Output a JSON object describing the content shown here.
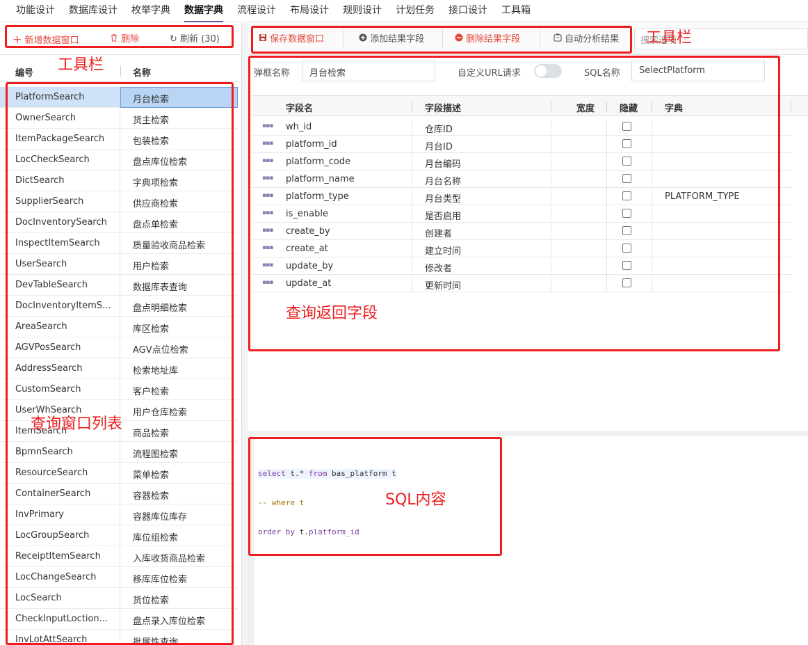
{
  "topnav": {
    "tabs": [
      {
        "label": "功能设计",
        "active": false
      },
      {
        "label": "数据库设计",
        "active": false
      },
      {
        "label": "枚举字典",
        "active": false
      },
      {
        "label": "数据字典",
        "active": true
      },
      {
        "label": "流程设计",
        "active": false
      },
      {
        "label": "布局设计",
        "active": false
      },
      {
        "label": "规则设计",
        "active": false
      },
      {
        "label": "计划任务",
        "active": false
      },
      {
        "label": "接口设计",
        "active": false
      },
      {
        "label": "工具箱",
        "active": false
      }
    ]
  },
  "left_toolbar": {
    "add_label": "新增数据窗口",
    "delete_label": "删除",
    "refresh_label": "刷新 (30)"
  },
  "left_table": {
    "headers": {
      "code": "编号",
      "name": "名称"
    },
    "rows": [
      {
        "code": "PlatformSearch",
        "name": "月台检索",
        "selected": true
      },
      {
        "code": "OwnerSearch",
        "name": "货主检索"
      },
      {
        "code": "ItemPackageSearch",
        "name": "包装检索"
      },
      {
        "code": "LocCheckSearch",
        "name": "盘点库位检索"
      },
      {
        "code": "DictSearch",
        "name": "字典项检索"
      },
      {
        "code": "SupplierSearch",
        "name": "供应商检索"
      },
      {
        "code": "DocInventorySearch",
        "name": "盘点单检索"
      },
      {
        "code": "InspectItemSearch",
        "name": "质量验收商品检索"
      },
      {
        "code": "UserSearch",
        "name": "用户检索"
      },
      {
        "code": "DevTableSearch",
        "name": "数据库表查询"
      },
      {
        "code": "DocInventoryItemS...",
        "name": "盘点明细检索"
      },
      {
        "code": "AreaSearch",
        "name": "库区检索"
      },
      {
        "code": "AGVPosSearch",
        "name": "AGV点位检索"
      },
      {
        "code": "AddressSearch",
        "name": "检索地址库"
      },
      {
        "code": "CustomSearch",
        "name": "客户检索"
      },
      {
        "code": "UserWhSearch",
        "name": "用户仓库检索"
      },
      {
        "code": "ItemSearch",
        "name": "商品检索"
      },
      {
        "code": "BpmnSearch",
        "name": "流程图检索"
      },
      {
        "code": "ResourceSearch",
        "name": "菜单检索"
      },
      {
        "code": "ContainerSearch",
        "name": "容器检索"
      },
      {
        "code": "InvPrimary",
        "name": "容器库位库存"
      },
      {
        "code": "LocGroupSearch",
        "name": "库位组检索"
      },
      {
        "code": "ReceiptItemSearch",
        "name": "入库收货商品检索"
      },
      {
        "code": "LocChangeSearch",
        "name": "移库库位检索"
      },
      {
        "code": "LocSearch",
        "name": "货位检索"
      },
      {
        "code": "CheckInputLoction...",
        "name": "盘点录入库位检索"
      },
      {
        "code": "InvLotAttSearch",
        "name": "批属性查询"
      }
    ]
  },
  "right_toolbar": {
    "save_label": "保存数据窗口",
    "add_field_label": "添加结果字段",
    "delete_field_label": "删除结果字段",
    "auto_analyze_label": "自动分析结果",
    "search_placeholder": "搜索选项"
  },
  "form": {
    "popup_name_label": "弹框名称",
    "popup_name_value": "月台检索",
    "custom_url_label": "自定义URL请求",
    "custom_url_enabled": false,
    "sql_name_label": "SQL名称",
    "sql_name_value": "SelectPlatform"
  },
  "fields_grid": {
    "headers": {
      "field": "字段名",
      "desc": "字段描述",
      "width": "宽度",
      "hidden": "隐藏",
      "dict": "字典"
    },
    "rows": [
      {
        "field": "wh_id",
        "desc": "仓库ID",
        "dict": ""
      },
      {
        "field": "platform_id",
        "desc": "月台ID",
        "dict": ""
      },
      {
        "field": "platform_code",
        "desc": "月台编码",
        "dict": ""
      },
      {
        "field": "platform_name",
        "desc": "月台名称",
        "dict": ""
      },
      {
        "field": "platform_type",
        "desc": "月台类型",
        "dict": "PLATFORM_TYPE"
      },
      {
        "field": "is_enable",
        "desc": "是否启用",
        "dict": ""
      },
      {
        "field": "create_by",
        "desc": "创建者",
        "dict": ""
      },
      {
        "field": "create_at",
        "desc": "建立时间",
        "dict": ""
      },
      {
        "field": "update_by",
        "desc": "修改者",
        "dict": ""
      },
      {
        "field": "update_at",
        "desc": "更新时间",
        "dict": ""
      }
    ]
  },
  "sql_editor": {
    "line1": {
      "k1": "select",
      "t1": " t.* ",
      "k2": "from",
      "t2": " bas_platform t"
    },
    "line2": "-- where t",
    "line3": {
      "k1": "order by",
      "t1": " t.",
      "t2": "platform_id"
    }
  },
  "annotations": {
    "toolbar_left": "工具栏",
    "toolbar_right": "工具栏",
    "query_window_list": "查询窗口列表",
    "query_return_fields": "查询返回字段",
    "sql_content": "SQL内容"
  },
  "colors": {
    "accent": "#6b4fa0",
    "danger": "#e5483c",
    "annotation": "#ee1c1c",
    "selection": "#cfe2f8"
  }
}
